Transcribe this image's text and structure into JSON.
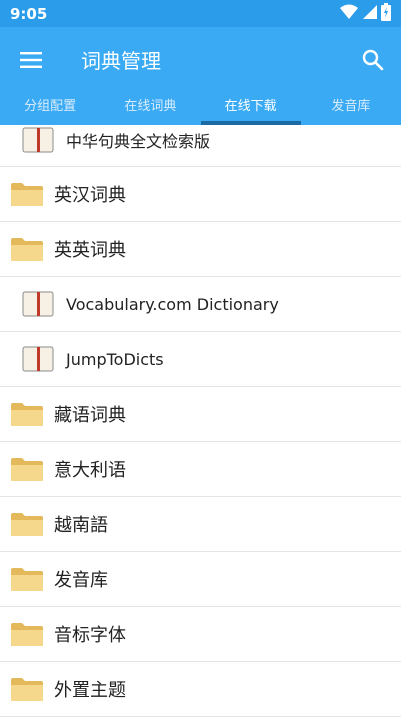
{
  "status": {
    "time": "9:05"
  },
  "appbar": {
    "title": "词典管理"
  },
  "tabs": [
    {
      "label": "分组配置",
      "active": false
    },
    {
      "label": "在线词典",
      "active": false
    },
    {
      "label": "在线下载",
      "active": true
    },
    {
      "label": "发音库",
      "active": false
    }
  ],
  "items": [
    {
      "label": "中华句典全文检索版",
      "icon": "book-icon"
    },
    {
      "label": "英汉词典",
      "icon": "folder-icon"
    },
    {
      "label": "英英词典",
      "icon": "folder-icon"
    },
    {
      "label": "Vocabulary.com Dictionary",
      "icon": "book-icon"
    },
    {
      "label": "JumpToDicts",
      "icon": "book-icon"
    },
    {
      "label": "藏语词典",
      "icon": "folder-icon"
    },
    {
      "label": "意大利语",
      "icon": "folder-icon"
    },
    {
      "label": "越南語",
      "icon": "folder-icon"
    },
    {
      "label": "发音库",
      "icon": "folder-icon"
    },
    {
      "label": "音标字体",
      "icon": "folder-icon"
    },
    {
      "label": "外置主题",
      "icon": "folder-icon"
    }
  ],
  "colors": {
    "accent": "#3aaaf5",
    "statusbar": "#2b9cea",
    "tab_indicator": "#1c6aa3"
  }
}
